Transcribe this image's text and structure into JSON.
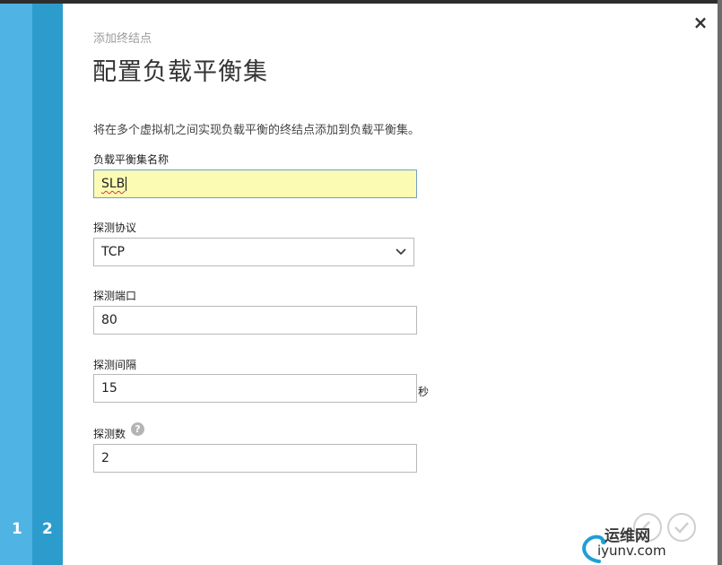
{
  "wizard": {
    "steps": [
      "1",
      "2"
    ],
    "close_icon": "×"
  },
  "header": {
    "subtitle": "添加终结点",
    "title": "配置负载平衡集"
  },
  "description": "将在多个虚拟机之间实现负载平衡的终结点添加到负载平衡集。",
  "form": {
    "name_label": "负载平衡集名称",
    "name_value": "SLB",
    "protocol_label": "探测协议",
    "protocol_value": "TCP",
    "port_label": "探测端口",
    "port_value": "80",
    "interval_label": "探测间隔",
    "interval_value": "15",
    "interval_unit": "秒",
    "count_label": "探测数",
    "count_help": "?",
    "count_value": "2"
  },
  "watermark": {
    "line1": "运维网",
    "line2": "iyunv.com"
  },
  "colors": {
    "rail_light": "#4fb3e3",
    "rail_dark": "#2c9ccd",
    "highlight_field": "#fbfbb4"
  },
  "icons": {
    "close": "close-icon",
    "chevron": "chevron-down-icon",
    "help": "help-icon",
    "back": "back-arrow-icon",
    "complete": "checkmark-icon"
  }
}
